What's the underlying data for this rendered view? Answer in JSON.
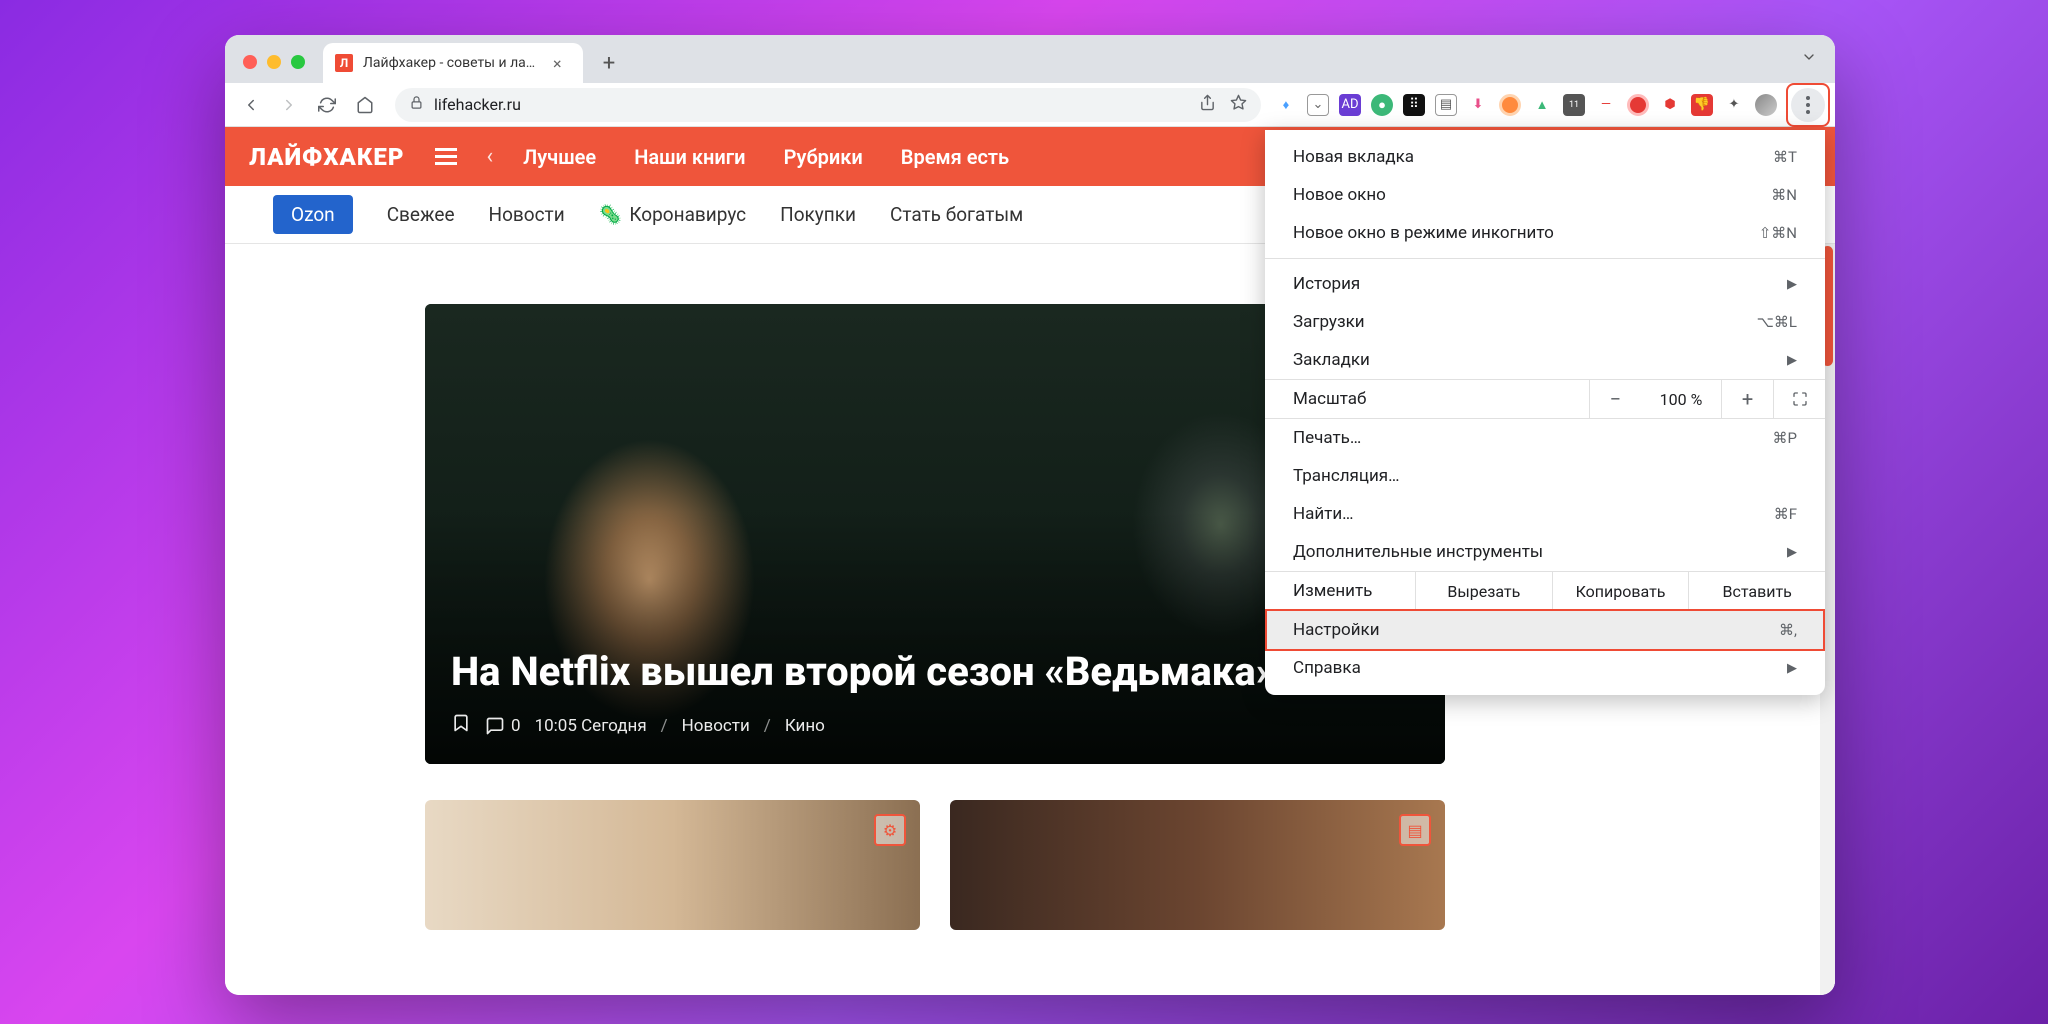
{
  "browser": {
    "tab": {
      "title": "Лайфхакер - советы и лайфха",
      "favicon_letter": "Л"
    },
    "url": "lifehacker.ru",
    "extensions": [
      {
        "name": "yandex",
        "bg": "transparent",
        "glyph": "♦",
        "color": "#4aa0ff"
      },
      {
        "name": "pocket",
        "bg": "transparent",
        "glyph": "⌄",
        "color": "#666",
        "border": "1px solid #999"
      },
      {
        "name": "adblock",
        "bg": "#6a3dd4",
        "glyph": "AD",
        "color": "#fff"
      },
      {
        "name": "green-circle",
        "bg": "#3cb878",
        "glyph": "●",
        "color": "#fff",
        "radius": "50%"
      },
      {
        "name": "dark-grid",
        "bg": "#111",
        "glyph": "⠿",
        "color": "#fff"
      },
      {
        "name": "notes",
        "bg": "transparent",
        "glyph": "▤",
        "color": "#555",
        "border": "1px solid #999"
      },
      {
        "name": "download",
        "bg": "transparent",
        "glyph": "⬇",
        "color": "#e94f8a"
      },
      {
        "name": "orange-dot",
        "bg": "#ff8a3d",
        "glyph": "",
        "radius": "50%",
        "border": "3px solid #ffd4b0"
      },
      {
        "name": "shield",
        "bg": "transparent",
        "glyph": "▲",
        "color": "#3cb878"
      },
      {
        "name": "badge-11",
        "bg": "#555",
        "glyph": "11",
        "color": "#fff",
        "fontSize": "9px"
      },
      {
        "name": "red-line",
        "bg": "transparent",
        "glyph": "—",
        "color": "#e53935"
      },
      {
        "name": "red-circle",
        "bg": "#e53935",
        "glyph": "",
        "radius": "50%",
        "border": "3px solid #fbb"
      },
      {
        "name": "drop",
        "bg": "transparent",
        "glyph": "⬢",
        "color": "#e53935"
      },
      {
        "name": "thumbs",
        "bg": "#e53935",
        "glyph": "👎",
        "color": "#fff"
      },
      {
        "name": "puzzle",
        "bg": "transparent",
        "glyph": "✦",
        "color": "#555"
      },
      {
        "name": "avatar",
        "bg": "linear-gradient(135deg,#888,#ccc)",
        "glyph": "",
        "radius": "50%"
      }
    ]
  },
  "site": {
    "logo": "ЛАЙФХАКЕР",
    "nav": [
      "Лучшее",
      "Наши книги",
      "Рубрики",
      "Время есть"
    ],
    "subnav": [
      {
        "label": "Ozon",
        "active": true
      },
      {
        "label": "Свежее"
      },
      {
        "label": "Новости"
      },
      {
        "label": "Коронавирус",
        "icon": "🦠"
      },
      {
        "label": "Покупки"
      },
      {
        "label": "Стать богатым"
      }
    ],
    "hero": {
      "title": "На Netflix вышел второй сезон «Ведьмака»",
      "comments": "0",
      "time": "10:05 Сегодня",
      "category": "Новости",
      "tag": "Кино"
    }
  },
  "menu": {
    "items": [
      {
        "label": "Новая вкладка",
        "shortcut": "⌘T",
        "type": "item"
      },
      {
        "label": "Новое окно",
        "shortcut": "⌘N",
        "type": "item"
      },
      {
        "label": "Новое окно в режиме инкогнито",
        "shortcut": "⇧⌘N",
        "type": "item"
      },
      {
        "type": "sep"
      },
      {
        "label": "История",
        "type": "submenu"
      },
      {
        "label": "Загрузки",
        "shortcut": "⌥⌘L",
        "type": "item"
      },
      {
        "label": "Закладки",
        "type": "submenu"
      },
      {
        "type": "zoom",
        "label": "Масштаб",
        "value": "100 %"
      },
      {
        "label": "Печать…",
        "shortcut": "⌘P",
        "type": "item"
      },
      {
        "label": "Трансляция…",
        "type": "item"
      },
      {
        "label": "Найти…",
        "shortcut": "⌘F",
        "type": "item"
      },
      {
        "label": "Дополнительные инструменты",
        "type": "submenu"
      },
      {
        "type": "edit",
        "label": "Изменить",
        "cut": "Вырезать",
        "copy": "Копировать",
        "paste": "Вставить"
      },
      {
        "label": "Настройки",
        "shortcut": "⌘,",
        "type": "item",
        "highlighted": true
      },
      {
        "label": "Справка",
        "type": "submenu"
      }
    ]
  }
}
